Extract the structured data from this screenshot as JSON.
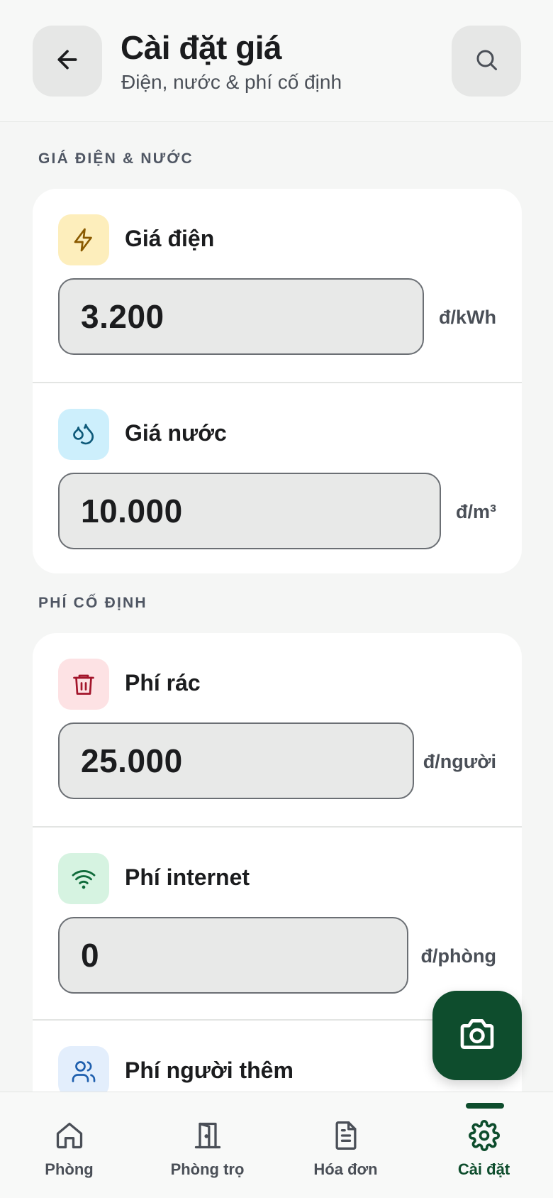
{
  "header": {
    "title": "Cài đặt giá",
    "subtitle": "Điện, nước & phí cố định",
    "back_icon": "arrow-left-icon",
    "search_icon": "search-icon"
  },
  "sections": {
    "utilities": {
      "label": "GIÁ ĐIỆN & NƯỚC",
      "rows": [
        {
          "title": "Giá điện",
          "value": "3.200",
          "unit": "đ/kWh",
          "icon": "lightning-icon",
          "icon_bg": "#fdeebc",
          "icon_color": "#8a5a00"
        },
        {
          "title": "Giá nước",
          "value": "10.000",
          "unit": "đ/m³",
          "icon": "water-drops-icon",
          "icon_bg": "#cdeffc",
          "icon_color": "#0e5a7a"
        }
      ]
    },
    "fixed": {
      "label": "PHÍ CỐ ĐỊNH",
      "rows": [
        {
          "title": "Phí rác",
          "value": "25.000",
          "unit": "đ/người",
          "icon": "trash-icon",
          "icon_bg": "#fde2e4",
          "icon_color": "#a3152b"
        },
        {
          "title": "Phí internet",
          "value": "0",
          "unit": "đ/phòng",
          "icon": "wifi-icon",
          "icon_bg": "#d6f3e1",
          "icon_color": "#0f6b3a"
        },
        {
          "title": "Phí người thêm",
          "icon": "users-icon",
          "icon_bg": "#e3eefc",
          "icon_color": "#1f5fae"
        }
      ]
    }
  },
  "fab": {
    "icon": "camera-icon",
    "color": "#0e4d2d"
  },
  "bottom_nav": {
    "items": [
      {
        "label": "Phòng",
        "icon": "home-icon"
      },
      {
        "label": "Phòng trọ",
        "icon": "door-icon"
      },
      {
        "label": "Hóa đơn",
        "icon": "invoice-icon"
      },
      {
        "label": "Cài đặt",
        "icon": "gear-icon",
        "active": true
      }
    ]
  }
}
